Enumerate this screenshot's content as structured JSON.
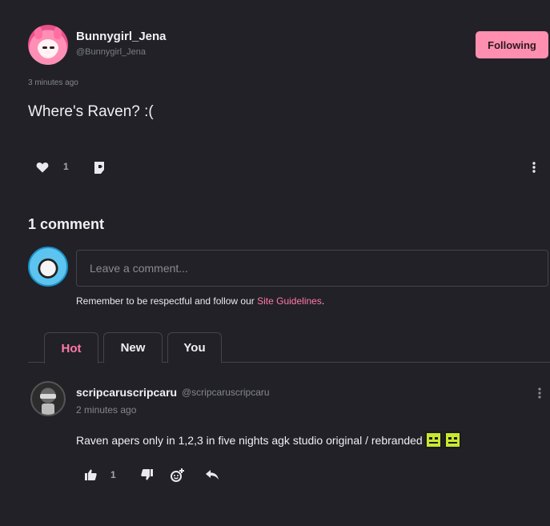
{
  "post": {
    "author_name": "Bunnygirl_Jena",
    "author_handle": "@Bunnygirl_Jena",
    "follow_label": "Following",
    "timestamp": "3 minutes ago",
    "text": "Where's Raven? :(",
    "like_count": "1"
  },
  "comments": {
    "heading": "1 comment",
    "input_placeholder": "Leave a comment...",
    "guidelines_prefix": "Remember to be respectful and follow our ",
    "guidelines_link": "Site Guidelines",
    "guidelines_suffix": ".",
    "tabs": [
      "Hot",
      "New",
      "You"
    ],
    "active_tab": "Hot",
    "items": [
      {
        "author_name": "scripcaruscripcaru",
        "author_handle": "@scripcaruscripcaru",
        "timestamp": "2 minutes ago",
        "text": "Raven apers only in 1,2,3 in five nights agk studio original / rebranded",
        "upvote_count": "1"
      }
    ]
  },
  "colors": {
    "background": "#212127",
    "accent_pink": "#ff8fb0",
    "link_pink": "#ff7aa8"
  },
  "icons": [
    "heart-icon",
    "share-icon",
    "more-vertical-icon",
    "thumbs-up-icon",
    "thumbs-down-icon",
    "add-reaction-icon",
    "reply-icon"
  ]
}
